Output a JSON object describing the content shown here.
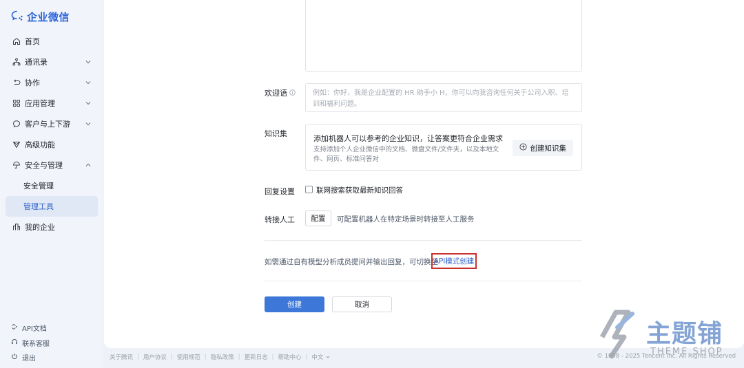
{
  "app": {
    "name": "企业微信"
  },
  "sidebar": {
    "items": [
      {
        "label": "首页",
        "icon": "home-icon"
      },
      {
        "label": "通讯录",
        "icon": "org-chart-icon"
      },
      {
        "label": "协作",
        "icon": "collaboration-icon"
      },
      {
        "label": "应用管理",
        "icon": "apps-grid-icon"
      },
      {
        "label": "客户与上下游",
        "icon": "chat-bubble-icon"
      },
      {
        "label": "高级功能",
        "icon": "diamond-icon"
      },
      {
        "label": "安全与管理",
        "icon": "umbrella-icon"
      },
      {
        "label": "安全管理"
      },
      {
        "label": "管理工具"
      },
      {
        "label": "我的企业",
        "icon": "building-icon"
      }
    ],
    "bottom": [
      {
        "label": "API文档",
        "icon": "api-doc-icon"
      },
      {
        "label": "联系客服",
        "icon": "headset-icon"
      },
      {
        "label": "退出",
        "icon": "logout-icon"
      }
    ]
  },
  "form": {
    "welcome_label": "欢迎语",
    "welcome_placeholder": "例如：你好，我是企业配置的 HR 助手小 H，你可以向我咨询任何关于公司入职、培训和福利问题。",
    "knowledge_label": "知识集",
    "knowledge_title": "添加机器人可以参考的企业知识，让答案更符合企业需求",
    "knowledge_desc": "支持添加个人企业微信中的文档、微盘文件/文件夹，以及本地文件、网页、标准问答对",
    "knowledge_button": "创建知识集",
    "reply_label": "回复设置",
    "reply_checkbox": "联网搜索获取最新知识回答",
    "handoff_label": "转接人工",
    "handoff_button": "配置",
    "handoff_desc": "可配置机器人在特定场景时转接至人工服务",
    "api_text": "如需通过自有模型分析成员提问并输出回复，可切换至",
    "api_link": "API模式创建",
    "create_button": "创建",
    "cancel_button": "取消"
  },
  "footer": {
    "links": [
      "关于腾讯",
      "用户协议",
      "使用规范",
      "隐私政策",
      "更新日志",
      "帮助中心",
      "中文"
    ],
    "copyright": "© 1998 - 2025 Tencent Inc. All Rights Reserved"
  },
  "watermark": {
    "text": "主题铺",
    "sub": "THEME SHOP"
  },
  "colors": {
    "primary": "#3d78d8",
    "link": "#2b5fc9",
    "highlight_border": "#c9302c",
    "sidebar_bg": "#f1f4fa",
    "active_bg": "#e1e8f5"
  }
}
